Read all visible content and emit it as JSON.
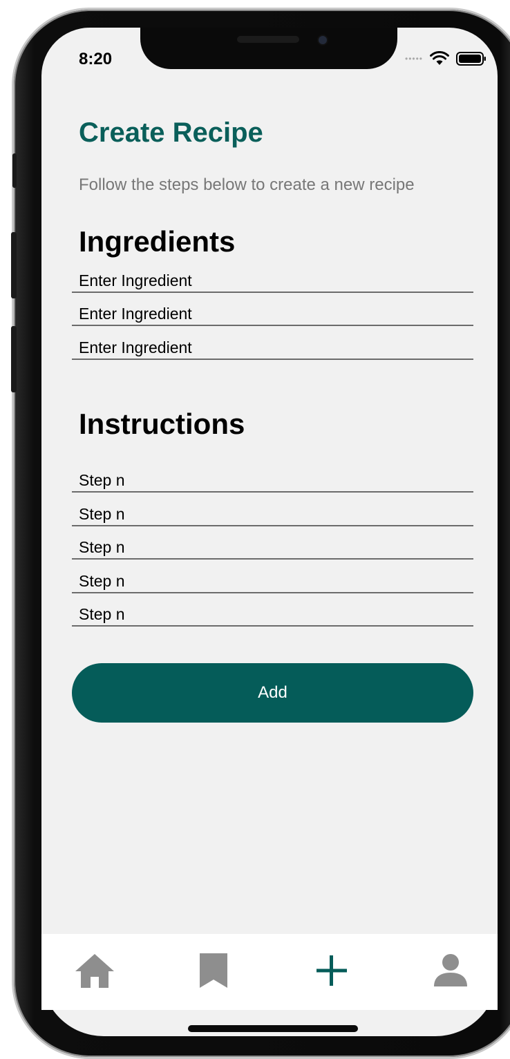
{
  "status_bar": {
    "time": "8:20",
    "signal_icon": "signal-dots-icon",
    "wifi_icon": "wifi-icon",
    "battery_icon": "battery-icon"
  },
  "header": {
    "title": "Create Recipe",
    "subtitle": "Follow the steps below to create a new recipe"
  },
  "ingredients": {
    "heading": "Ingredients",
    "fields": [
      {
        "placeholder": "Enter Ingredient",
        "value": ""
      },
      {
        "placeholder": "Enter Ingredient",
        "value": ""
      },
      {
        "placeholder": "Enter Ingredient",
        "value": ""
      }
    ]
  },
  "instructions": {
    "heading": "Instructions",
    "fields": [
      {
        "placeholder": "Step n",
        "value": ""
      },
      {
        "placeholder": "Step n",
        "value": ""
      },
      {
        "placeholder": "Step n",
        "value": ""
      },
      {
        "placeholder": "Step n",
        "value": ""
      },
      {
        "placeholder": "Step n",
        "value": ""
      }
    ]
  },
  "actions": {
    "add_label": "Add"
  },
  "tab_bar": {
    "tabs": [
      {
        "icon": "home-icon",
        "active": false
      },
      {
        "icon": "bookmark-icon",
        "active": false
      },
      {
        "icon": "plus-icon",
        "active": true
      },
      {
        "icon": "profile-icon",
        "active": false
      }
    ]
  },
  "colors": {
    "accent": "#055c59",
    "title": "#0a5f5a",
    "subtitle": "#777777",
    "inactive_icon": "#8e8e8e",
    "screen_background": "#f1f1f1"
  }
}
